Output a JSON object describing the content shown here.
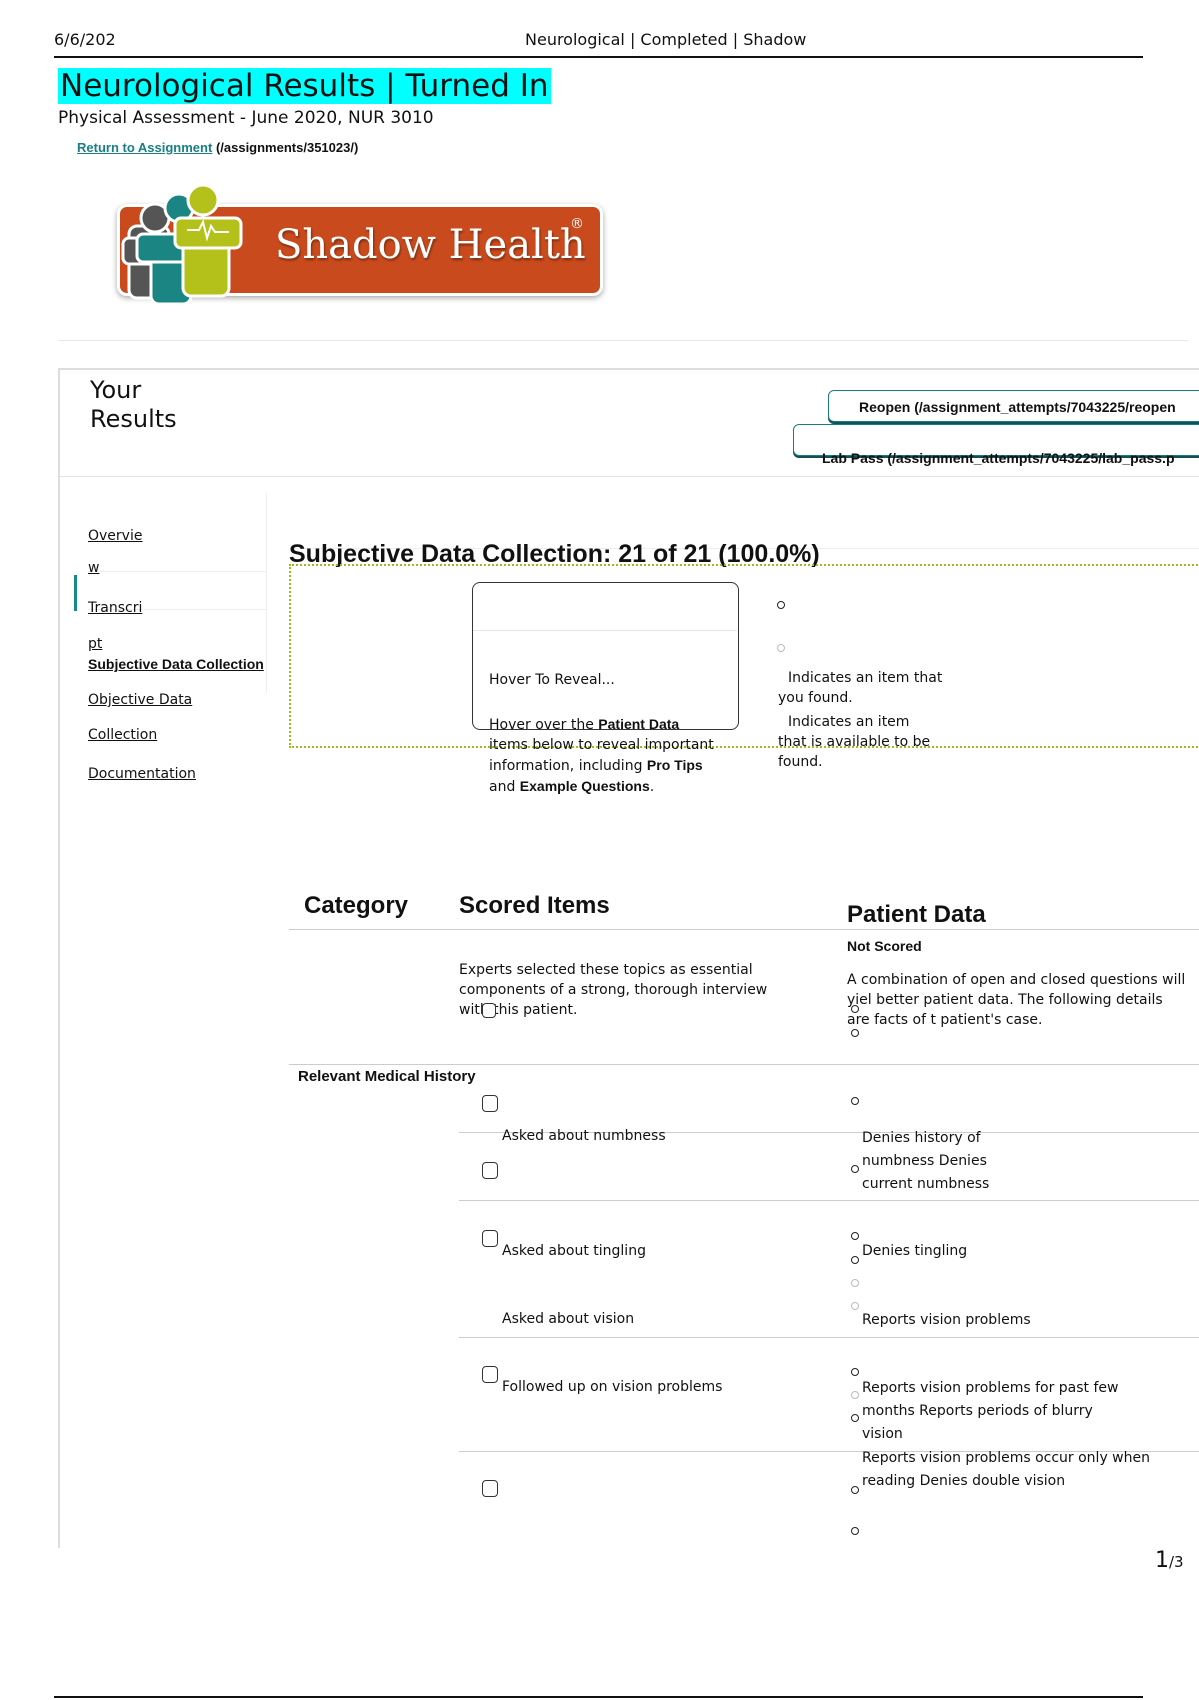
{
  "print_header": {
    "date": "6/6/202",
    "title": "Neurological | Completed | Shadow"
  },
  "page": {
    "title": "Neurological Results | Turned In",
    "subtitle": "Physical Assessment - June 2020, NUR 3010",
    "return_link_label": "Return to Assignment",
    "return_link_path": "(/assignments/351023/)"
  },
  "logo": {
    "text": "Shadow Health",
    "registered": "®"
  },
  "results": {
    "heading_line1": "Your",
    "heading_line2": "Results",
    "reopen_label": "Reopen (/assignment_attempts/7043225/reopen",
    "lab_pass_label": "Lab Pass (/assignment_attempts/7043225/lab_pass.p"
  },
  "sidebar": {
    "items": [
      {
        "label": "Overvie",
        "label_cont": "w"
      },
      {
        "label": "Transcri",
        "label_cont": "pt"
      },
      {
        "label": "Subjective Data Collection"
      },
      {
        "label": "Objective Data ",
        "label_cont": "Collection"
      },
      {
        "label": "Documentation"
      }
    ]
  },
  "section": {
    "title": "Subjective Data Collection: 21 of 21 (100.0%)",
    "found": 21,
    "total": 21,
    "percent": 100.0
  },
  "hover_info": {
    "title": "Hover To Reveal...",
    "text_pre": "Hover over the ",
    "bold1": "Patient Data",
    "text_mid1": " items below to reveal important information, including ",
    "bold2": "Pro Tips",
    "text_mid2": " and ",
    "bold3": "Example Questions",
    "text_end": "."
  },
  "legend": {
    "found": "Indicates an item that you found.",
    "available": "Indicates an item that is available to be found."
  },
  "table": {
    "headers": {
      "category": "Category",
      "scored_items": "Scored Items",
      "patient_data": "Patient Data"
    },
    "not_scored": "Not Scored",
    "scored_intro": "Experts selected these topics as essential components of a strong, thorough interview with this patient.",
    "patient_intro": "A combination of open and closed questions will yiel better patient data. The following details are facts of t patient's case.",
    "category": "Relevant Medical History",
    "rows": [
      {
        "item": "Asked about numbness",
        "patient_data": [
          "Denies history of",
          "numbness Denies",
          "current numbness"
        ]
      },
      {
        "item": "Asked about tingling",
        "patient_data": [
          "Denies tingling"
        ]
      },
      {
        "item": "Asked about vision",
        "patient_data": [
          "Reports vision problems"
        ]
      },
      {
        "item": "Followed up on vision problems",
        "patient_data": [
          "Reports vision problems for past few",
          "months Reports periods of blurry",
          "vision",
          "Reports vision problems occur only when",
          "reading Denies double vision"
        ]
      }
    ]
  },
  "footer": {
    "page": "1",
    "of": "/3"
  }
}
